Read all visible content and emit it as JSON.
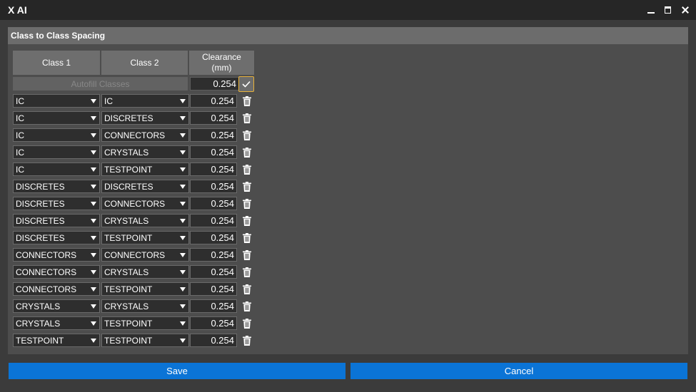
{
  "window": {
    "title": "X AI",
    "controls": [
      "minimize-icon",
      "maximize-icon",
      "close-icon"
    ]
  },
  "panel": {
    "header": "Class to Class Spacing",
    "columns": {
      "class1": "Class 1",
      "class2": "Class 2",
      "clearance": "Clearance\n(mm)"
    },
    "autofill": {
      "label": "Autofill Classes",
      "value": "0.254",
      "apply_icon": "checkmark-icon"
    },
    "rows": [
      {
        "class1": "IC",
        "class2": "IC",
        "clearance": "0.254"
      },
      {
        "class1": "IC",
        "class2": "DISCRETES",
        "clearance": "0.254"
      },
      {
        "class1": "IC",
        "class2": "CONNECTORS",
        "clearance": "0.254"
      },
      {
        "class1": "IC",
        "class2": "CRYSTALS",
        "clearance": "0.254"
      },
      {
        "class1": "IC",
        "class2": "TESTPOINT",
        "clearance": "0.254"
      },
      {
        "class1": "DISCRETES",
        "class2": "DISCRETES",
        "clearance": "0.254"
      },
      {
        "class1": "DISCRETES",
        "class2": "CONNECTORS",
        "clearance": "0.254"
      },
      {
        "class1": "DISCRETES",
        "class2": "CRYSTALS",
        "clearance": "0.254"
      },
      {
        "class1": "DISCRETES",
        "class2": "TESTPOINT",
        "clearance": "0.254"
      },
      {
        "class1": "CONNECTORS",
        "class2": "CONNECTORS",
        "clearance": "0.254"
      },
      {
        "class1": "CONNECTORS",
        "class2": "CRYSTALS",
        "clearance": "0.254"
      },
      {
        "class1": "CONNECTORS",
        "class2": "TESTPOINT",
        "clearance": "0.254"
      },
      {
        "class1": "CRYSTALS",
        "class2": "CRYSTALS",
        "clearance": "0.254"
      },
      {
        "class1": "CRYSTALS",
        "class2": "TESTPOINT",
        "clearance": "0.254"
      },
      {
        "class1": "TESTPOINT",
        "class2": "TESTPOINT",
        "clearance": "0.254"
      }
    ],
    "row_icon": "trash-icon"
  },
  "footer": {
    "save_label": "Save",
    "cancel_label": "Cancel"
  },
  "colors": {
    "accent": "#0b74d6",
    "focus": "#e8b23a"
  }
}
